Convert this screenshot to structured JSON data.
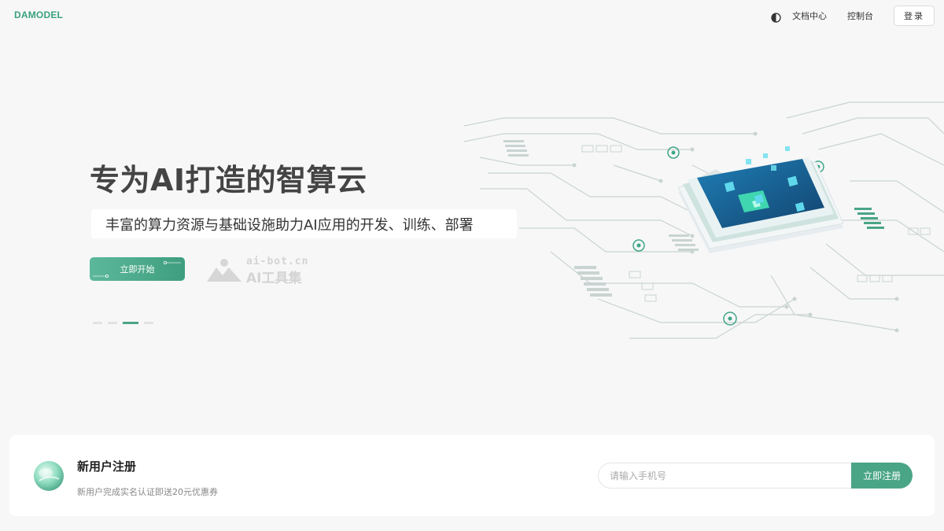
{
  "header": {
    "logo": "DAMODEL",
    "theme_icon": "half-circle-contrast-icon",
    "docs_label": "文档中心",
    "console_label": "控制台",
    "login_label": "登录"
  },
  "hero": {
    "title": "专为AI打造的智算云",
    "subtitle": "丰富的算力资源与基础设施助力AI应用的开发、训练、部署",
    "start_label": "立即开始",
    "watermark": {
      "line1": "ai-bot.cn",
      "line2": "AI工具集"
    },
    "carousel": {
      "count": 4,
      "active_index": 2
    }
  },
  "register": {
    "title": "新用户注册",
    "description": "新用户完成实名认证即送20元优惠券",
    "phone_placeholder": "请输入手机号",
    "submit_label": "立即注册"
  },
  "colors": {
    "accent": "#4aa587",
    "logo": "#3aa17e",
    "chip_top": "#1b6fa3",
    "chip_core": "#3fd6b0"
  }
}
